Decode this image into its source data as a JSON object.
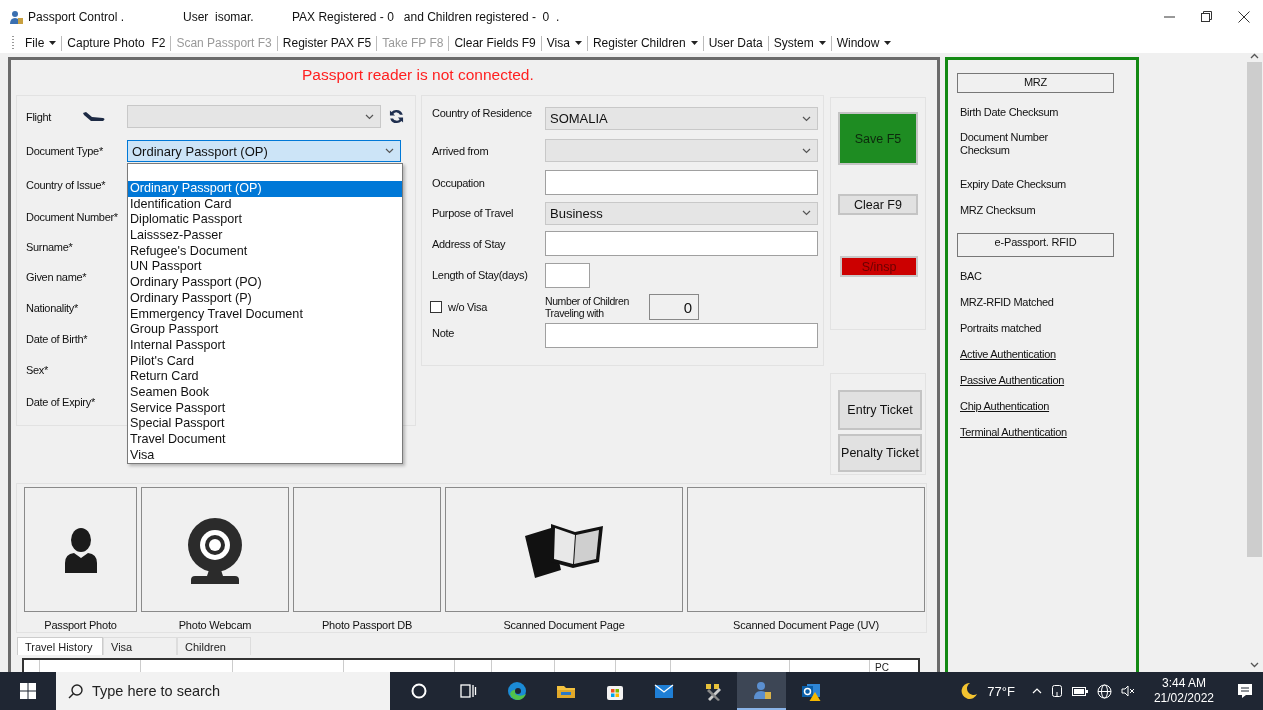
{
  "window": {
    "title": "Passport Control .",
    "user": "User  isomar.",
    "summary": "PAX Registered - 0   and Children registered -  0  ."
  },
  "menu": [
    {
      "label": "File",
      "dropdown": true,
      "disabled": false
    },
    {
      "label": "Capture Photo  F2",
      "dropdown": false,
      "disabled": false
    },
    {
      "label": "Scan Passport F3",
      "dropdown": false,
      "disabled": true
    },
    {
      "label": "Register PAX F5",
      "dropdown": false,
      "disabled": false
    },
    {
      "label": "Take FP F8",
      "dropdown": false,
      "disabled": true
    },
    {
      "label": "Clear Fields F9",
      "dropdown": false,
      "disabled": false
    },
    {
      "label": "Visa",
      "dropdown": true,
      "disabled": false
    },
    {
      "label": "Register Children",
      "dropdown": true,
      "disabled": false
    },
    {
      "label": "User Data",
      "dropdown": false,
      "disabled": false
    },
    {
      "label": "System",
      "dropdown": true,
      "disabled": false
    },
    {
      "label": "Window",
      "dropdown": true,
      "disabled": false
    }
  ],
  "status_message": "Passport reader is not connected.",
  "document_form": {
    "fields": [
      {
        "kind": "flight",
        "label": "Flight",
        "focused": false
      },
      {
        "kind": "combo",
        "label": "Document Type*",
        "value": "Ordinary Passport (OP)",
        "focused": true
      },
      {
        "kind": "covered",
        "label": "Country of Issue*"
      },
      {
        "kind": "covered",
        "label": "Document Number*"
      },
      {
        "kind": "covered",
        "label": "Surname*"
      },
      {
        "kind": "covered",
        "label": "Given name*"
      },
      {
        "kind": "covered",
        "label": "Nationality*"
      },
      {
        "kind": "covered",
        "label": "Date of Birth*"
      },
      {
        "kind": "covered",
        "label": "Sex*"
      },
      {
        "kind": "covered",
        "label": "Date of Expiry*"
      }
    ],
    "dropdown": {
      "options": [
        {
          "label": "Ordinary Passport (OP)",
          "selected": true
        },
        {
          "label": "Identification Card",
          "selected": false
        },
        {
          "label": "Diplomatic Passport",
          "selected": false
        },
        {
          "label": "Laisssez-Passer",
          "selected": false
        },
        {
          "label": "Refugee's Document",
          "selected": false
        },
        {
          "label": "UN Passport",
          "selected": false
        },
        {
          "label": "Ordinary Passport (PO)",
          "selected": false
        },
        {
          "label": "Ordinary Passport (P)",
          "selected": false
        },
        {
          "label": "Emmergency Travel Document",
          "selected": false
        },
        {
          "label": "Group Passport",
          "selected": false
        },
        {
          "label": "Internal Passport",
          "selected": false
        },
        {
          "label": "Pilot's Card",
          "selected": false
        },
        {
          "label": "Return Card",
          "selected": false
        },
        {
          "label": "Seamen Book",
          "selected": false
        },
        {
          "label": "Service Passport",
          "selected": false
        },
        {
          "label": "Special Passport",
          "selected": false
        },
        {
          "label": "Travel Document",
          "selected": false
        },
        {
          "label": "Visa",
          "selected": false
        }
      ]
    }
  },
  "travel_form": {
    "fields": [
      {
        "kind": "combo",
        "label": "Country of Residence",
        "value": "SOMALIA"
      },
      {
        "kind": "combo",
        "label": "Arrived from"
      },
      {
        "kind": "input",
        "label": "Occupation"
      },
      {
        "kind": "combo",
        "label": "Purpose of Travel",
        "value": "Business"
      },
      {
        "kind": "input",
        "label": "Address of Stay"
      },
      {
        "kind": "short_input",
        "label": "Length of Stay(days)"
      },
      {
        "kind": "visa_children",
        "label": "w/o Visa",
        "checked": false,
        "count_label": "Number of Children Traveling with",
        "count": "0"
      },
      {
        "kind": "note",
        "label": "Note"
      }
    ]
  },
  "actions": [
    {
      "kind": "save",
      "label": "Save F5"
    },
    {
      "kind": "plain",
      "label": "Clear F9"
    },
    {
      "kind": "alert",
      "label": "S/insp"
    }
  ],
  "tickets": [
    {
      "label": "Entry Ticket"
    },
    {
      "label": "Penalty Ticket"
    }
  ],
  "images": [
    {
      "kind": "person",
      "caption": "Passport Photo"
    },
    {
      "kind": "webcam",
      "caption": "Photo Webcam"
    },
    {
      "kind": "empty",
      "caption": "Photo Passport DB"
    },
    {
      "kind": "document",
      "caption": "Scanned Document Page"
    },
    {
      "kind": "empty",
      "caption": "Scanned Document Page (UV)"
    }
  ],
  "tabs": [
    {
      "label": "Travel History",
      "selected": true
    },
    {
      "label": "Visa",
      "selected": false
    },
    {
      "label": "Children",
      "selected": false
    }
  ],
  "table": {
    "columns": [
      {
        "label": "PC"
      }
    ]
  },
  "verification": [
    {
      "kind": "header",
      "label": "MRZ"
    },
    {
      "kind": "check",
      "label": "Birth Date Checksum"
    },
    {
      "kind": "check",
      "label": "Document Number Checksum"
    },
    {
      "kind": "check",
      "label": "Expiry Date Checksum"
    },
    {
      "kind": "check",
      "label": "MRZ Checksum"
    },
    {
      "kind": "header",
      "label": "e-Passport. RFID"
    },
    {
      "kind": "check",
      "label": "BAC"
    },
    {
      "kind": "check",
      "label": "MRZ-RFID Matched"
    },
    {
      "kind": "check",
      "label": "Portraits matched"
    },
    {
      "kind": "link",
      "label": "Active Authentication"
    },
    {
      "kind": "link",
      "label": "Passive Authentication"
    },
    {
      "kind": "link",
      "label": "Chip Authentication"
    },
    {
      "kind": "link",
      "label": "Terminal Authentication"
    }
  ],
  "taskbar": {
    "search": {
      "placeholder": "Type here to search"
    },
    "apps": [
      {
        "kind": "cortana",
        "active": false
      },
      {
        "kind": "task_view",
        "active": false
      },
      {
        "kind": "edge",
        "active": false
      },
      {
        "kind": "explorer",
        "active": false
      },
      {
        "kind": "store",
        "active": false
      },
      {
        "kind": "mail",
        "active": false
      },
      {
        "kind": "tool",
        "active": false
      },
      {
        "kind": "passport",
        "active": true
      },
      {
        "kind": "outlook",
        "active": false
      }
    ],
    "temperature": "77°F",
    "time": "3:44 AM",
    "date": "21/02/2022"
  }
}
